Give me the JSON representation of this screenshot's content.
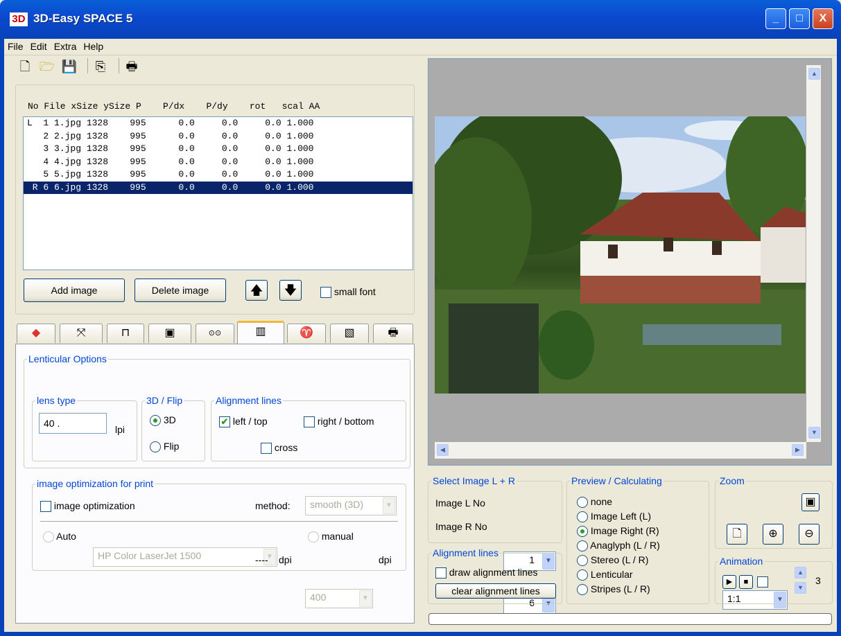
{
  "app": {
    "icon_text": "3D",
    "title": "3D-Easy SPACE 5",
    "minimize": "_",
    "maximize": "□",
    "close": "X"
  },
  "menu": [
    "File",
    "Edit",
    "Extra",
    "Help"
  ],
  "toolbar": {
    "icons": [
      "new-file-icon",
      "open-folder-icon",
      "save-icon",
      "copy-icon",
      "print-icon"
    ]
  },
  "list": {
    "header": "No File xSize ySize P    P/dx    P/dy    rot   scal AA",
    "rows": [
      {
        "text": "L  1 1.jpg 1328    995      0.0     0.0     0.0 1.000",
        "selected": false
      },
      {
        "text": "   2 2.jpg 1328    995      0.0     0.0     0.0 1.000",
        "selected": false
      },
      {
        "text": "   3 3.jpg 1328    995      0.0     0.0     0.0 1.000",
        "selected": false
      },
      {
        "text": "   4 4.jpg 1328    995      0.0     0.0     0.0 1.000",
        "selected": false
      },
      {
        "text": "   5 5.jpg 1328    995      0.0     0.0     0.0 1.000",
        "selected": false
      },
      {
        "text": " R 6 6.jpg 1328    995      0.0     0.0     0.0 1.000",
        "selected": true
      }
    ]
  },
  "list_buttons": {
    "add": "Add image",
    "delete": "Delete image",
    "up": "🡅",
    "down": "🡇",
    "small_font": "small font"
  },
  "tabs": [
    "color-icon",
    "transform-icon",
    "crop-icon",
    "image-icon",
    "stereo-icon",
    "lenticular-icon",
    "animation-icon",
    "edit-icon",
    "print-icon"
  ],
  "tab_glyphs": [
    "◆",
    "⤧",
    "⊓",
    "▣",
    "⊙⊙",
    "▥",
    "♈",
    "▧",
    "🖶"
  ],
  "lenticular": {
    "title": "Lenticular Options",
    "lens_type_label": "lens type",
    "lens_value": "40 .",
    "lens_unit": "lpi",
    "flip_group": "3D / Flip",
    "opt_3d": "3D",
    "opt_flip": "Flip",
    "align_group": "Alignment lines",
    "left_top": "left / top",
    "right_bottom": "right / bottom",
    "cross": "cross"
  },
  "optimization": {
    "group": "image optimization for print",
    "checkbox": "image optimization",
    "method_label": "method:",
    "method_value": "smooth (3D)",
    "auto": "Auto",
    "printer": "HP Color LaserJet 1500",
    "manual": "manual",
    "dpi_dashes": "----",
    "dpi_label": "dpi",
    "dpi_value": "400",
    "dpi_label2": "dpi"
  },
  "select_image": {
    "group": "Select Image L + R",
    "left_label": "Image L No",
    "left_value": "1",
    "right_label": "Image R No",
    "right_value": "6"
  },
  "alignment": {
    "group": "Alignment lines",
    "draw": "draw alignment lines",
    "clear": "clear alignment lines"
  },
  "preview": {
    "group": "Preview / Calculating",
    "options": [
      "none",
      "Image Left (L)",
      "Image Right (R)",
      "Anaglyph (L / R)",
      "Stereo (L / R)",
      "Lenticular",
      "Stripes (L / R)"
    ],
    "selected_index": 2
  },
  "zoom": {
    "group": "Zoom",
    "value": "1:1"
  },
  "animation": {
    "group": "Animation",
    "count": "3"
  }
}
